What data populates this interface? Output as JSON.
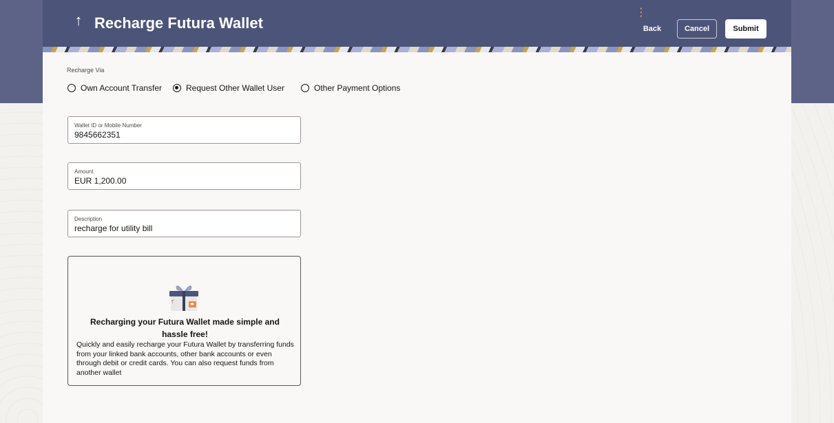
{
  "header": {
    "title": "Recharge Futura Wallet",
    "back_arrow_icon": "arrow-up-icon",
    "kebab_icon": "kebab-menu-icon",
    "back_label": "Back",
    "cancel_label": "Cancel",
    "submit_label": "Submit"
  },
  "form": {
    "recharge_via_label": "Recharge Via",
    "options": [
      {
        "label": "Own Account Transfer",
        "selected": false
      },
      {
        "label": "Request Other Wallet User",
        "selected": true
      },
      {
        "label": "Other Payment Options",
        "selected": false
      }
    ],
    "wallet": {
      "label": "Wallet ID or Mobile Number",
      "value": "9845662351"
    },
    "amount": {
      "label": "Amount",
      "value": "EUR 1,200.00"
    },
    "description": {
      "label": "Description",
      "value": "recharge for utility bill"
    }
  },
  "info": {
    "icon": "gift-box-icon",
    "title": "Recharging your Futura Wallet made simple and hassle free!",
    "text": "Quickly and easily recharge your Futura Wallet by transferring funds from your linked bank accounts, other bank accounts or even through debit or credit cards. You can also request funds from another wallet"
  },
  "colors": {
    "header": "#4c5479",
    "page_top": "#5c6387",
    "accent": "#e3b34a",
    "card": "#f9f8f6"
  }
}
